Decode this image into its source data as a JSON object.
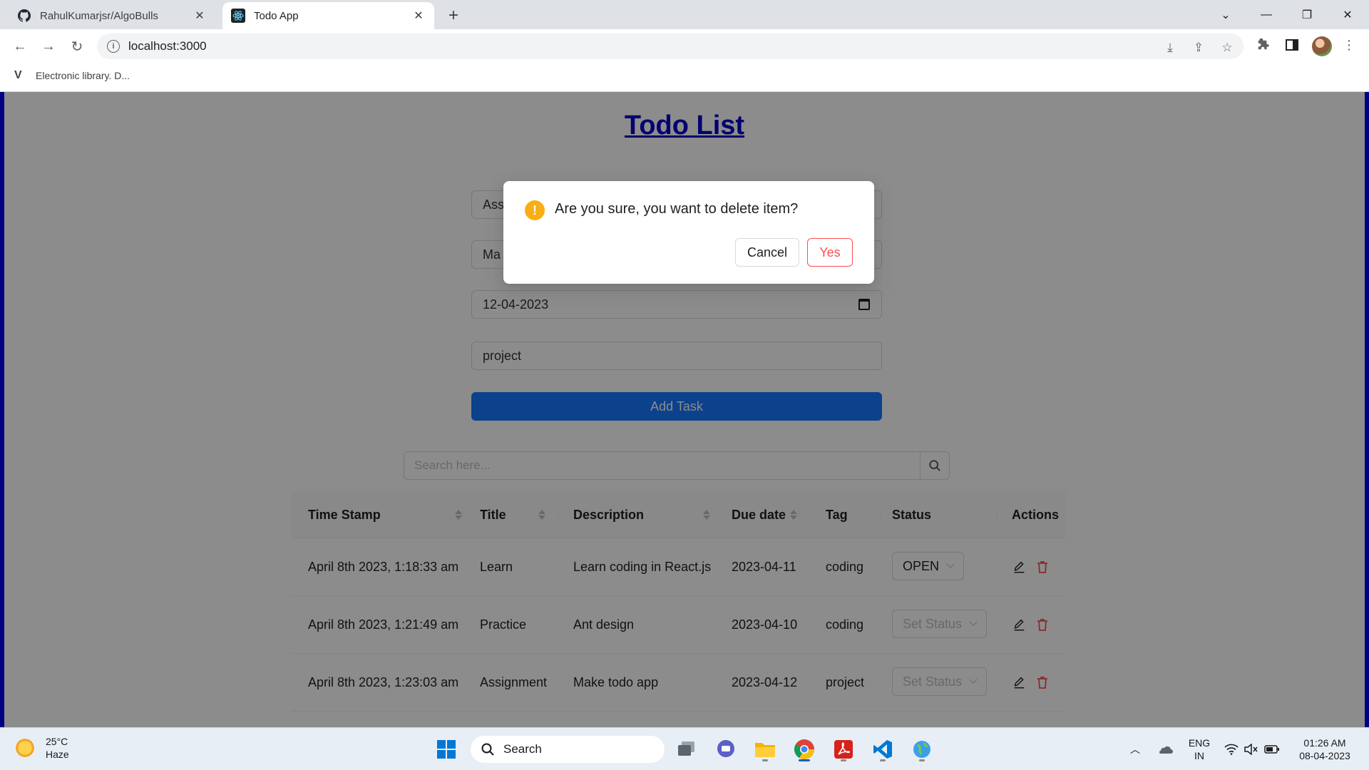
{
  "browser": {
    "tabs": [
      {
        "title": "RahulKumarjsr/AlgoBulls",
        "favicon": "github-icon",
        "active": false
      },
      {
        "title": "Todo App",
        "favicon": "react-icon",
        "active": true
      }
    ],
    "url": "localhost:3000",
    "bookmarks": [
      {
        "label": "Electronic library. D...",
        "icon": "v-icon"
      }
    ]
  },
  "page": {
    "title": "Todo List",
    "form": {
      "title_value": "Ass",
      "description_value": "Ma",
      "due_date_value": "12-04-2023",
      "tag_value": "project",
      "add_button": "Add Task"
    },
    "search": {
      "placeholder": "Search here..."
    },
    "table": {
      "columns": [
        "Time Stamp",
        "Title",
        "Description",
        "Due date",
        "Tag",
        "Status",
        "Actions"
      ],
      "rows": [
        {
          "timestamp": "April 8th 2023, 1:18:33 am",
          "title": "Learn",
          "description": "Learn coding in React.js",
          "due": "2023-04-11",
          "tag": "coding",
          "status": "OPEN",
          "status_placeholder": false
        },
        {
          "timestamp": "April 8th 2023, 1:21:49 am",
          "title": "Practice",
          "description": "Ant design",
          "due": "2023-04-10",
          "tag": "coding",
          "status": "Set Status",
          "status_placeholder": true
        },
        {
          "timestamp": "April 8th 2023, 1:23:03 am",
          "title": "Assignment",
          "description": "Make todo app",
          "due": "2023-04-12",
          "tag": "project",
          "status": "Set Status",
          "status_placeholder": true
        }
      ]
    }
  },
  "modal": {
    "message": "Are you sure, you want to delete item?",
    "cancel": "Cancel",
    "confirm": "Yes"
  },
  "taskbar": {
    "weather_temp": "25°C",
    "weather_desc": "Haze",
    "search_label": "Search",
    "lang_line1": "ENG",
    "lang_line2": "IN",
    "time": "01:26 AM",
    "date": "08-04-2023"
  },
  "colors": {
    "primary": "#1677ff",
    "danger": "#ff4d4f",
    "warning": "#faad14",
    "frame": "#000080"
  }
}
